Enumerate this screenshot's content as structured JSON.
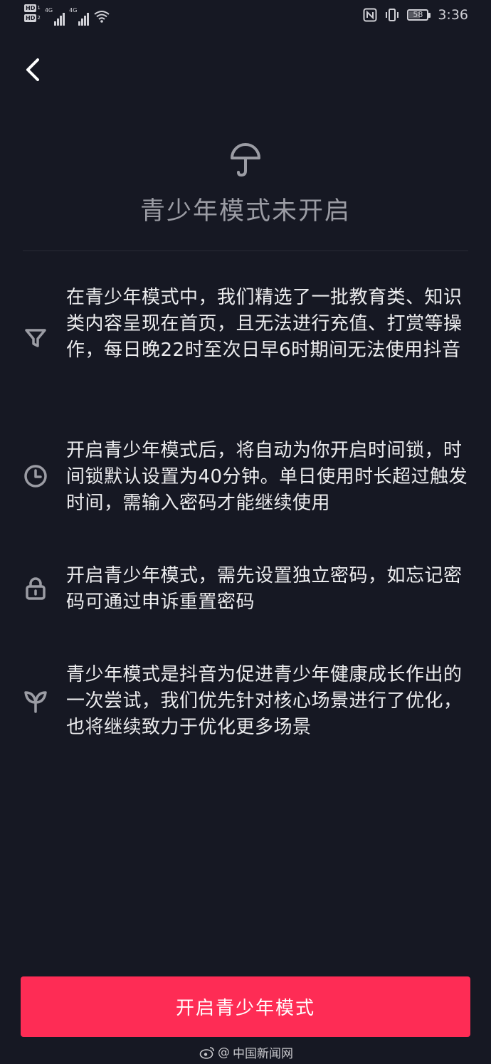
{
  "status_bar": {
    "hd_label": "HD",
    "sim1": "1",
    "sim2": "2",
    "network1": "4G",
    "network2": "4G",
    "battery_level": "58",
    "time": "3:36"
  },
  "nav": {
    "back_icon": "chevron-left-icon"
  },
  "header": {
    "icon": "umbrella-icon",
    "title": "青少年模式未开启"
  },
  "features": [
    {
      "icon": "filter-icon",
      "text": "在青少年模式中，我们精选了一批教育类、知识类内容呈现在首页，且无法进行充值、打赏等操作，每日晚22时至次日早6时期间无法使用抖音"
    },
    {
      "icon": "clock-icon",
      "text": "开启青少年模式后，将自动为你开启时间锁，时间锁默认设置为40分钟。单日使用时长超过触发时间，需输入密码才能继续使用"
    },
    {
      "icon": "lock-icon",
      "text": "开启青少年模式，需先设置独立密码，如忘记密码可通过申诉重置密码"
    },
    {
      "icon": "sprout-icon",
      "text": "青少年模式是抖音为促进青少年健康成长作出的一次尝试，我们优先针对核心场景进行了优化，也将继续致力于优化更多场景"
    }
  ],
  "cta": {
    "label": "开启青少年模式"
  },
  "watermark": {
    "at": "@",
    "source": "中国新闻网"
  },
  "colors": {
    "background": "#161823",
    "accent": "#fe2c55",
    "title": "#9b9ca4",
    "text": "#ececee"
  }
}
